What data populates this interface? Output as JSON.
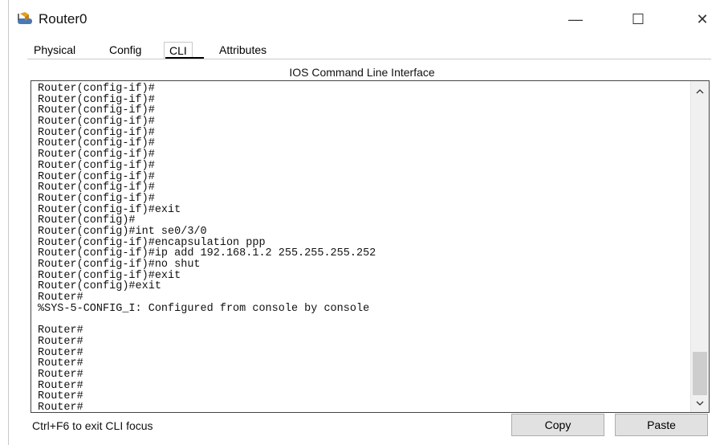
{
  "window": {
    "title": "Router0",
    "icon": "router-icon",
    "controls": {
      "minimize": "—",
      "maximize": "☐",
      "close": "✕"
    }
  },
  "tabs": [
    {
      "label": "Physical"
    },
    {
      "label": "Config"
    },
    {
      "label": "CLI",
      "active": true
    },
    {
      "label": "Attributes"
    }
  ],
  "panel": {
    "title": "IOS Command Line Interface"
  },
  "terminal": {
    "lines": [
      "Router(config-if)#",
      "Router(config-if)#",
      "Router(config-if)#",
      "Router(config-if)#",
      "Router(config-if)#",
      "Router(config-if)#",
      "Router(config-if)#",
      "Router(config-if)#",
      "Router(config-if)#",
      "Router(config-if)#",
      "Router(config-if)#",
      "Router(config-if)#exit",
      "Router(config)#",
      "Router(config)#int se0/3/0",
      "Router(config-if)#encapsulation ppp",
      "Router(config-if)#ip add 192.168.1.2 255.255.255.252",
      "Router(config-if)#no shut",
      "Router(config-if)#exit",
      "Router(config)#exit",
      "Router#",
      "%SYS-5-CONFIG_I: Configured from console by console",
      "",
      "Router#",
      "Router#",
      "Router#",
      "Router#",
      "Router#",
      "Router#",
      "Router#",
      "Router#"
    ]
  },
  "footer": {
    "hint": "Ctrl+F6 to exit CLI focus",
    "copy_label": "Copy",
    "paste_label": "Paste"
  }
}
